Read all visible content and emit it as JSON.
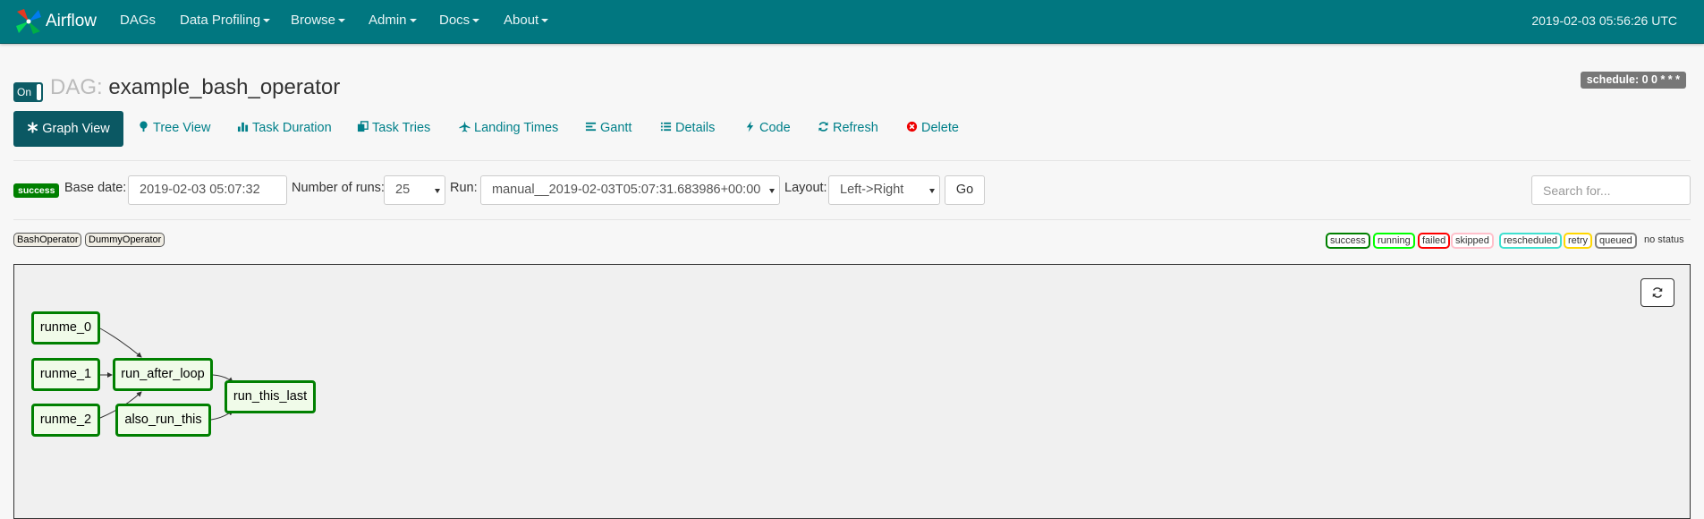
{
  "navbar": {
    "brand": "Airflow",
    "items": [
      {
        "label": "DAGs"
      },
      {
        "label": "Data Profiling"
      },
      {
        "label": "Browse"
      },
      {
        "label": "Admin"
      },
      {
        "label": "Docs"
      },
      {
        "label": "About"
      }
    ],
    "time": "2019-02-03 05:56:26 UTC"
  },
  "header": {
    "toggle_label": "On",
    "dag_prefix": "DAG:",
    "dag_id": "example_bash_operator",
    "schedule": "schedule: 0 0 * * *"
  },
  "tabs": [
    {
      "label": "Graph View",
      "icon": "asterisk-icon"
    },
    {
      "label": "Tree View",
      "icon": "tree-icon"
    },
    {
      "label": "Task Duration",
      "icon": "stats-icon"
    },
    {
      "label": "Task Tries",
      "icon": "duplicate-icon"
    },
    {
      "label": "Landing Times",
      "icon": "plane-icon"
    },
    {
      "label": "Gantt",
      "icon": "align-left-icon"
    },
    {
      "label": "Details",
      "icon": "list-icon"
    },
    {
      "label": "Code",
      "icon": "flash-icon"
    },
    {
      "label": "Refresh",
      "icon": "refresh-icon"
    },
    {
      "label": "Delete",
      "icon": "remove-circle-icon"
    }
  ],
  "controls": {
    "state_badge": "success",
    "base_date_label": "Base date:",
    "base_date_value": "2019-02-03 05:07:32",
    "num_runs_label": "Number of runs:",
    "num_runs_value": "25",
    "run_label": "Run:",
    "run_value": "manual__2019-02-03T05:07:31.683986+00:00",
    "layout_label": "Layout:",
    "layout_value": "Left->Right",
    "go_label": "Go",
    "search_placeholder": "Search for..."
  },
  "operator_legend": [
    "BashOperator",
    "DummyOperator"
  ],
  "state_legend": [
    {
      "label": "success",
      "color": "#008000"
    },
    {
      "label": "running",
      "color": "#00ff00"
    },
    {
      "label": "failed",
      "color": "#ff0000"
    },
    {
      "label": "skipped",
      "color": "#ffc0cb"
    },
    {
      "label": "rescheduled",
      "color": "#40e0d0"
    },
    {
      "label": "retry",
      "color": "#ffd700"
    },
    {
      "label": "queued",
      "color": "#808080"
    }
  ],
  "no_status_label": "no status",
  "graph": {
    "nodes": [
      {
        "id": "runme_0",
        "label": "runme_0",
        "state": "success"
      },
      {
        "id": "runme_1",
        "label": "runme_1",
        "state": "success"
      },
      {
        "id": "runme_2",
        "label": "runme_2",
        "state": "success"
      },
      {
        "id": "run_after_loop",
        "label": "run_after_loop",
        "state": "success"
      },
      {
        "id": "also_run_this",
        "label": "also_run_this",
        "state": "success"
      },
      {
        "id": "run_this_last",
        "label": "run_this_last",
        "state": "success"
      }
    ],
    "edges": [
      {
        "from": "runme_0",
        "to": "run_after_loop"
      },
      {
        "from": "runme_1",
        "to": "run_after_loop"
      },
      {
        "from": "runme_2",
        "to": "run_after_loop"
      },
      {
        "from": "run_after_loop",
        "to": "run_this_last"
      },
      {
        "from": "also_run_this",
        "to": "run_this_last"
      }
    ]
  }
}
